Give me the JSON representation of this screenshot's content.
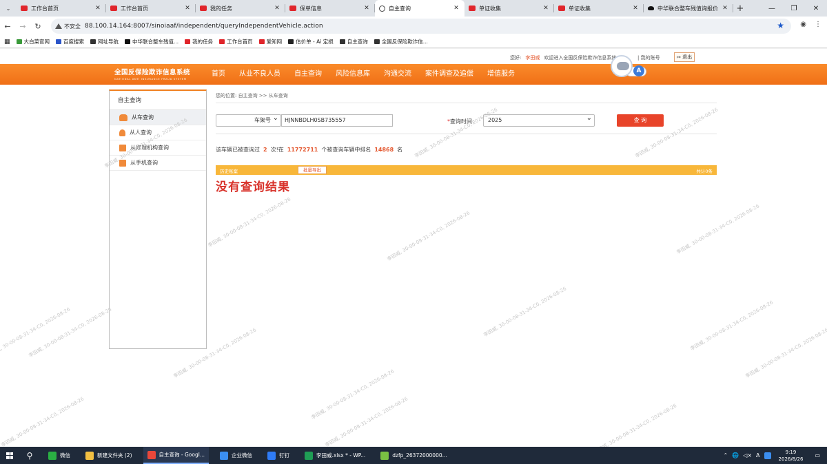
{
  "tabs": [
    {
      "title": "工作台首页",
      "icon": "picc-icon"
    },
    {
      "title": "工作台首页",
      "icon": "picc-icon"
    },
    {
      "title": "我的任务",
      "icon": "picc-icon"
    },
    {
      "title": "保单信息",
      "icon": "picc-icon"
    },
    {
      "title": "自主查询",
      "icon": "globe-icon",
      "active": true
    },
    {
      "title": "单证收集",
      "icon": "picc-icon"
    },
    {
      "title": "单证收集",
      "icon": "picc-icon"
    },
    {
      "title": "中华联合整车残值询报价",
      "icon": "car-icon"
    }
  ],
  "address": {
    "security_label": "不安全",
    "url": "88.100.14.164:8007/sinoiaaf/independent/queryIndependentVehicle.action"
  },
  "bookmarks": [
    {
      "label": "大白菜官网",
      "color": "#3a9a3a"
    },
    {
      "label": "百度搜索",
      "color": "#2b55c9"
    },
    {
      "label": "网址导航",
      "color": "#333333"
    },
    {
      "label": "中华联合整车残值...",
      "color": "#111111"
    },
    {
      "label": "我的任务",
      "color": "#e0252b"
    },
    {
      "label": "工作台首页",
      "color": "#e0252b"
    },
    {
      "label": "爱知网",
      "color": "#e0252b"
    },
    {
      "label": "估价单 - Ai 定损",
      "color": "#222222"
    },
    {
      "label": "自主查询",
      "color": "#333333"
    },
    {
      "label": "全国反保险欺诈信...",
      "color": "#333333"
    }
  ],
  "site": {
    "greeting_prefix": "您好:",
    "user_name": "李田威",
    "welcome_text": "欢迎进入全国反保险欺诈信息系统",
    "my_account": "| 我的账号",
    "logout": "退出",
    "logo_cn": "全国反保险欺诈信息系统",
    "logo_en": "NATIONAL ANTI INSURANCE FRAUD SYSTEM",
    "assistant_letter": "A"
  },
  "nav": [
    "首页",
    "从业不良人员",
    "自主查询",
    "风险信息库",
    "沟通交流",
    "案件调查及追偿",
    "增值服务"
  ],
  "sidebar": {
    "title": "自主查询",
    "items": [
      {
        "label": "从车查询",
        "active": true
      },
      {
        "label": "从人查询"
      },
      {
        "label": "从修理机构查询"
      },
      {
        "label": "从手机查询"
      }
    ]
  },
  "breadcrumb": "您的位置: 自主查询 >> 从车查询",
  "form": {
    "type_value": "车架号",
    "vin_value": "HJNNBDLH0SB735557",
    "time_label": "查询时间:",
    "year_value": "2025",
    "query_button": "查 询"
  },
  "stats": {
    "t1": "该车辆已被查询过",
    "count": "2",
    "t2": "次!在",
    "total": "11772711",
    "t3": "个被查询车辆中排名",
    "rank": "14868",
    "t4": "名"
  },
  "history": {
    "label": "历史账案",
    "export": "批量导出",
    "total": "共计0条",
    "empty": "没有查询结果"
  },
  "watermark": "李田威, 30-00-08-31-34-C0, 2026-08-26",
  "taskbar": {
    "apps": [
      {
        "label": "微信",
        "color": "#2aae43"
      },
      {
        "label": "新建文件夹 (2)",
        "color": "#f3c042"
      },
      {
        "label": "自主查询 - Googl...",
        "color": "#e9473a",
        "open": true
      },
      {
        "label": "企业微信",
        "color": "#3b8ef0"
      },
      {
        "label": "钉钉",
        "color": "#2f7cf6"
      },
      {
        "label": "李田威.xlsx * - WP...",
        "color": "#1f9d55"
      },
      {
        "label": "dzfp_26372000000...",
        "color": "#7ac143"
      }
    ],
    "time": "9:19",
    "date": "2026/8/26",
    "ime": "A"
  }
}
